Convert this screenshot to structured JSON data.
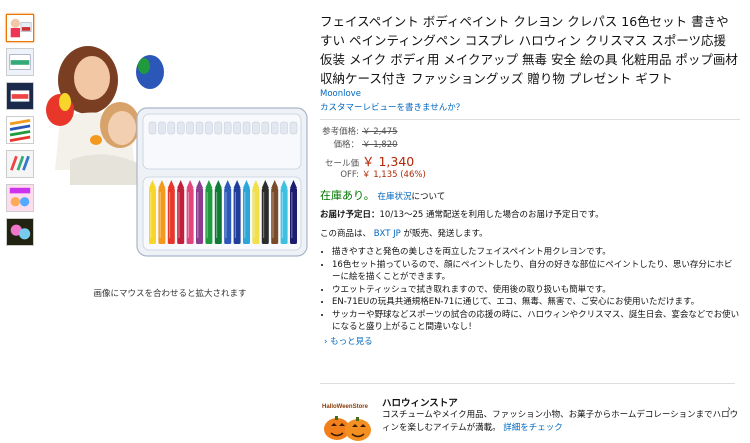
{
  "product": {
    "title": "フェイスペイント ボディペイント クレヨン クレパス 16色セット 書きやすい ペインティングペン コスプレ ハロウィン クリスマス スポーツ応援 仮装 メイク ボディ用 メイクアップ 無毒 安全 絵の具 化粧用品 ポップ画材 収納ケース付き ファッショングッズ 贈り物 プレゼント ギフト",
    "brand": "Moonlove",
    "review_prompt": "カスタマーレビューを書きませんか？"
  },
  "prices": {
    "ref_label": "参考価格:",
    "ref_value": "￥ 2,475",
    "list_label": "価格：",
    "list_value": "￥ 1,820",
    "sale_label": "セール価",
    "sale_value": "￥ 1,340",
    "off_label": "OFF:",
    "off_value": "￥ 1,135 (46%)"
  },
  "stock": {
    "status": "在庫あり。",
    "link": "在庫状況",
    "suffix": "について"
  },
  "delivery": {
    "label": "お届け予定日：",
    "text": "10/13～25 通常配送を利用した場合のお届け予定日です。"
  },
  "seller": {
    "prefix": "この商品は、",
    "name": "BXT JP",
    "suffix": "が販売、発送します。"
  },
  "bullets": [
    "描きやすさと発色の美しさを両立したフェイスペイント用クレヨンです。",
    "16色セット揃っているので、顔にペイントしたり、自分の好きな部位にペイントしたり、思い存分にホビーに絵を描くことができます。",
    "ウエットティッシュで拭き取れますので、使用後の取り扱いも簡単です。",
    "EN-71EUの玩具共通規格EN-71に通じて、エコ、無毒、無害で、ご安心にお使用いただけます。",
    "サッカーや野球などスポーツの試合の応援の時に、ハロウィンやクリスマス、誕生日会、宴会などでお使いになると盛り上がること間違いなし！"
  ],
  "more_link": "もっと見る",
  "zoom_hint": "画像にマウスを合わせると拡大されます",
  "store": {
    "logo_text": "HalloWeenStore",
    "title": "ハロウィンストア",
    "desc": "コスチュームやメイク用品、ファッション小物、お菓子からホームデコレーションまでハロウィンを楽しむアイテムが満載。",
    "link": "詳細をチェック"
  },
  "colors": {
    "link": "#0066c0",
    "price": "#b12704",
    "stock": "#007600",
    "accent": "#e77600"
  },
  "crayon_colors": [
    "#f7d52b",
    "#f39a1e",
    "#e8362a",
    "#c21f3a",
    "#e0457b",
    "#8e3c8f",
    "#1f9a3c",
    "#0f7a33",
    "#2a57b8",
    "#1e3e9a",
    "#2ba6d8",
    "#f1e04a",
    "#2c2c2c",
    "#7a4b2a",
    "#3ec0e0",
    "#1c1c6e"
  ]
}
